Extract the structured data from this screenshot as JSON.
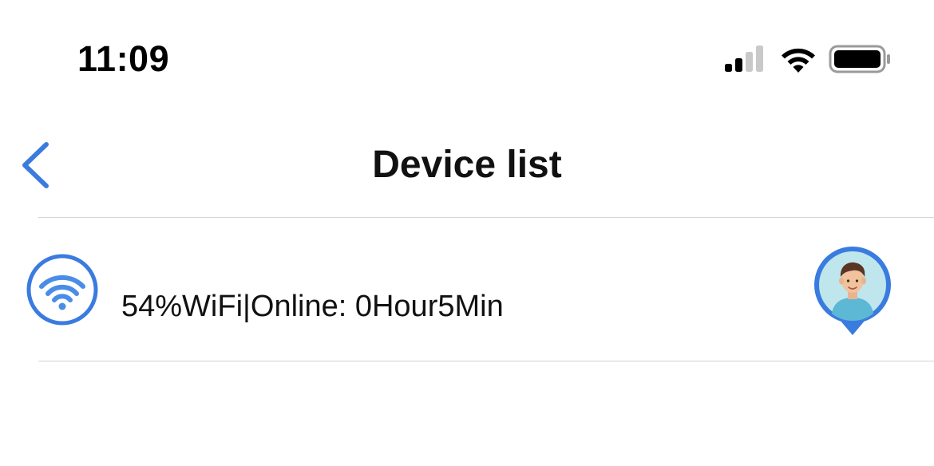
{
  "status_bar": {
    "time": "11:09",
    "icons": [
      "cellular-signal-icon",
      "wifi-icon",
      "battery-icon"
    ]
  },
  "nav": {
    "back_icon": "chevron-left-icon",
    "title": "Device list"
  },
  "devices": [
    {
      "status_icon": "wifi-icon",
      "status_text": "54%WiFi|Online: 0Hour5Min",
      "avatar_icon": "location-pin-avatar-icon"
    }
  ],
  "colors": {
    "accent": "#3a7be0",
    "avatar_bg": "#bfe6ec",
    "divider": "#d4d4d4"
  }
}
